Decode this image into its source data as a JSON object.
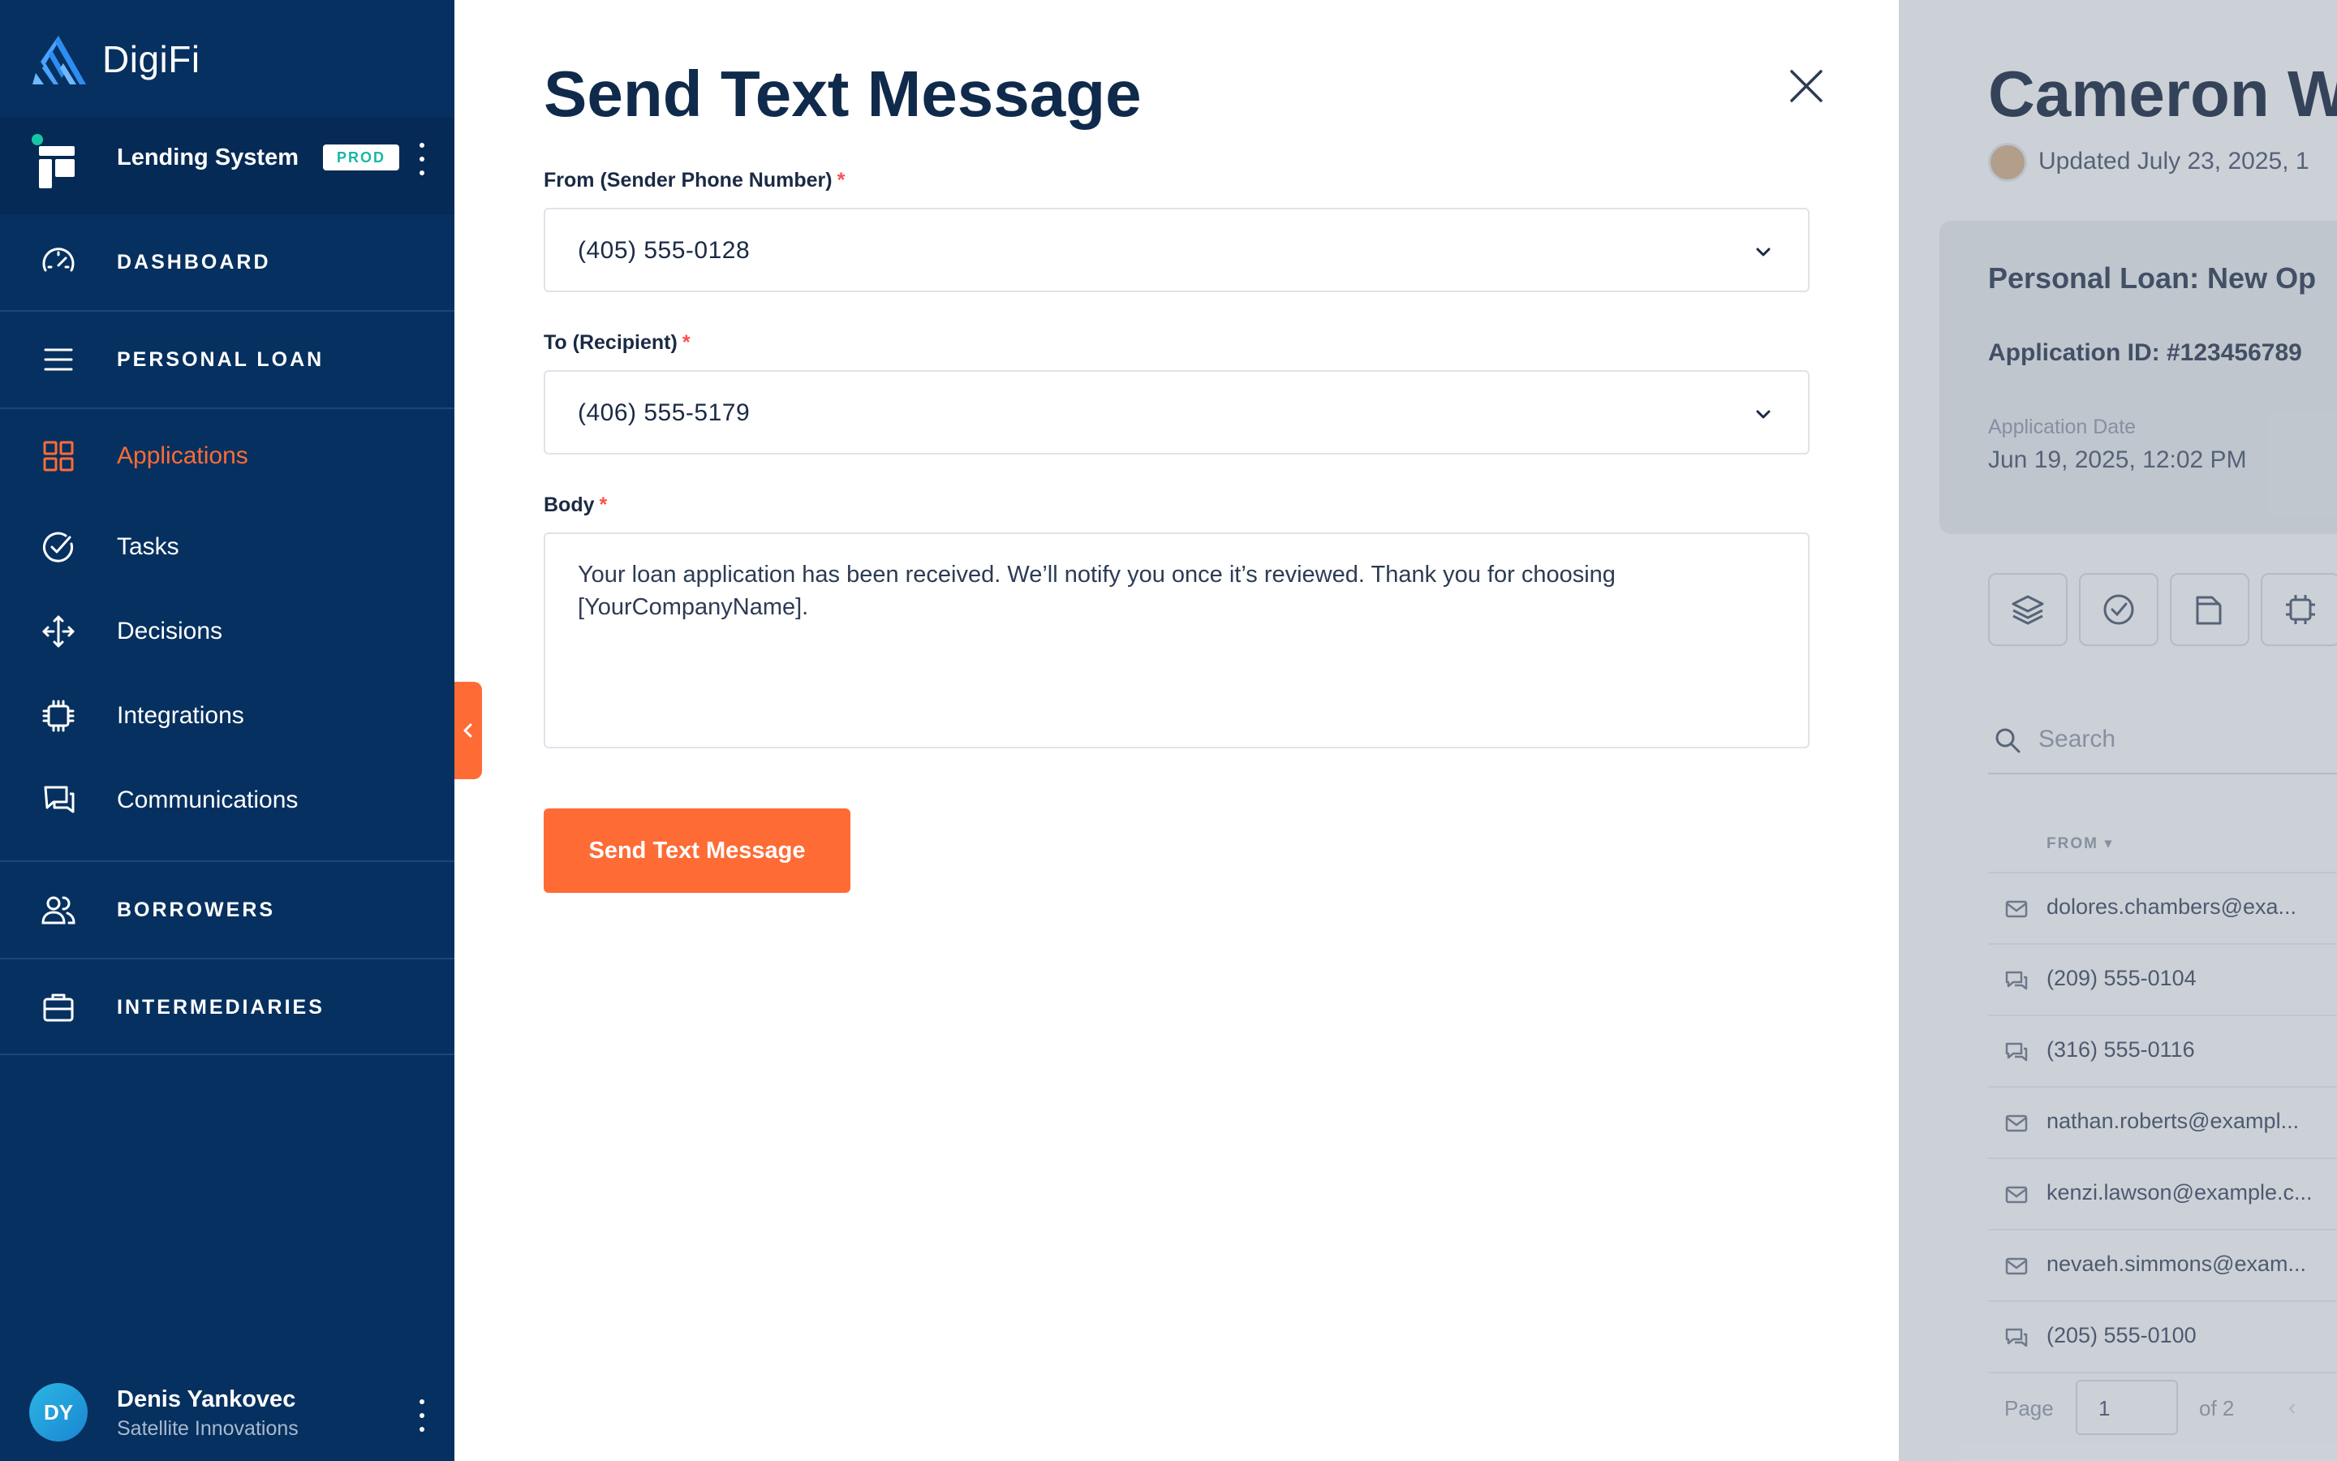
{
  "app": {
    "brand": "DigiFi",
    "system_name": "Lending System",
    "environment_badge": "PROD"
  },
  "sidebar": {
    "items": [
      {
        "label": "DASHBOARD",
        "icon": "speedometer-icon",
        "section": true
      },
      {
        "label": "PERSONAL LOAN",
        "icon": "menu-icon",
        "section": true
      },
      {
        "label": "Applications",
        "icon": "grid-icon",
        "active": true
      },
      {
        "label": "Tasks",
        "icon": "check-circle-icon"
      },
      {
        "label": "Decisions",
        "icon": "arrows-split-icon"
      },
      {
        "label": "Integrations",
        "icon": "chip-icon"
      },
      {
        "label": "Communications",
        "icon": "chat-bubbles-icon"
      },
      {
        "label": "BORROWERS",
        "icon": "users-icon",
        "section": true
      },
      {
        "label": "INTERMEDIARIES",
        "icon": "briefcase-icon",
        "section": true
      }
    ],
    "user": {
      "initials": "DY",
      "name": "Denis Yankovec",
      "organization": "Satellite Innovations"
    }
  },
  "modal": {
    "title": "Send Text Message",
    "from_label": "From (Sender Phone Number)",
    "from_value": "(405) 555-0128",
    "to_label": "To (Recipient)",
    "to_value": "(406) 555-5179",
    "body_label": "Body",
    "body_value": "Your loan application has been received. We’ll notify you once it’s reviewed. Thank you for choosing [YourCompanyName].",
    "required_mark": "*",
    "submit_label": "Send Text Message"
  },
  "background_page": {
    "title": "Cameron W",
    "updated": "Updated July 23, 2025, 1",
    "card_title": "Personal Loan: New Op",
    "application_id": "Application ID: #123456789",
    "application_date_label": "Application Date",
    "application_date": "Jun 19, 2025, 12:02 PM",
    "search_placeholder": "Search",
    "column_from": "FROM ▾",
    "rows": [
      {
        "type": "email",
        "from": "dolores.chambers@exa..."
      },
      {
        "type": "sms",
        "from": "(209) 555-0104"
      },
      {
        "type": "sms",
        "from": "(316) 555-0116"
      },
      {
        "type": "email",
        "from": "nathan.roberts@exampl..."
      },
      {
        "type": "email",
        "from": "kenzi.lawson@example.c..."
      },
      {
        "type": "email",
        "from": "nevaeh.simmons@exam..."
      },
      {
        "type": "sms",
        "from": "(205) 555-0100"
      }
    ],
    "pager": {
      "label": "Page",
      "current": "1",
      "of": "of 2"
    }
  },
  "colors": {
    "sidebar_bg": "#06305f",
    "accent": "#ff6b35",
    "title_text": "#102a4c",
    "badge_text": "#18b7a6"
  }
}
